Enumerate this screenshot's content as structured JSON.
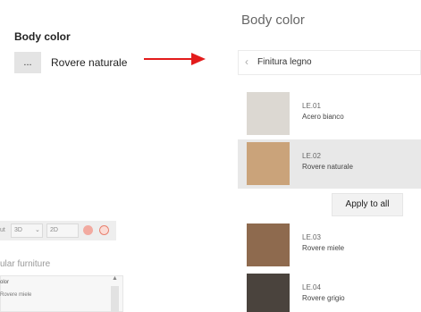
{
  "left": {
    "title": "Body color",
    "button_label": "...",
    "value": "Rovere naturale"
  },
  "colors": {
    "arrow": "#e31c1c"
  },
  "background_app": {
    "toolbar": {
      "truncated_label": "ut",
      "view_3d": "3D",
      "view_2d": "2D"
    },
    "heading": "ular furniture",
    "property_label": "olor",
    "property_value": "Rovere miele",
    "caret": "▲"
  },
  "panel": {
    "title": "Body color",
    "back_label": "Finitura legno",
    "apply_label": "Apply to all",
    "items": [
      {
        "code": "LE.01",
        "name": "Acero bianco",
        "color": "#dcd8d2",
        "selected": false
      },
      {
        "code": "LE.02",
        "name": "Rovere naturale",
        "color": "#caa37a",
        "selected": true
      },
      {
        "code": "LE.03",
        "name": "Rovere miele",
        "color": "#8e6a4e",
        "selected": false
      },
      {
        "code": "LE.04",
        "name": "Rovere grigio",
        "color": "#4a433d",
        "selected": false
      }
    ]
  }
}
